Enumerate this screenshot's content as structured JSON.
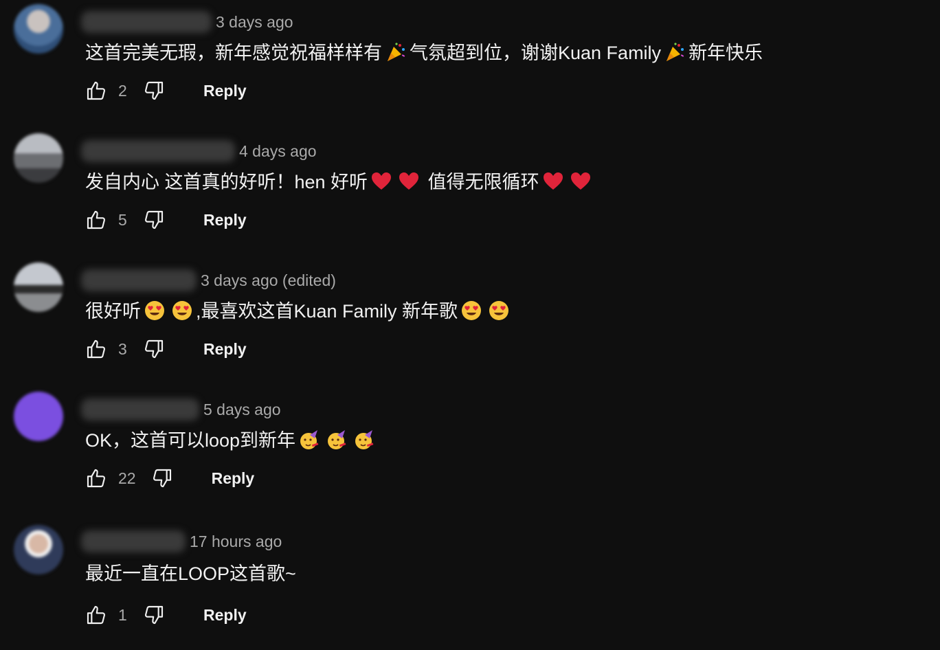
{
  "comments": [
    {
      "timestamp": "3 days ago",
      "text_parts": [
        "这首完美无瑕，新年感觉祝福样样有",
        "气氛超到位，谢谢Kuan Family",
        "新年快乐"
      ],
      "emojis": [
        "party-popper",
        "party-popper"
      ],
      "likes": "2",
      "reply_label": "Reply"
    },
    {
      "timestamp": "4 days ago",
      "text_parts": [
        "发自内心 这首真的好听！hen 好听",
        "值得无限循环"
      ],
      "emojis": [
        "red-heart",
        "red-heart",
        "red-heart",
        "red-heart"
      ],
      "likes": "5",
      "reply_label": "Reply"
    },
    {
      "timestamp": "3 days ago (edited)",
      "text_parts": [
        "很好听",
        ",最喜欢这首Kuan Family 新年歌"
      ],
      "emojis": [
        "heart-eyes",
        "heart-eyes",
        "heart-eyes",
        "heart-eyes"
      ],
      "likes": "3",
      "reply_label": "Reply"
    },
    {
      "timestamp": "5 days ago",
      "text_parts": [
        "OK，这首可以loop到新年"
      ],
      "emojis": [
        "partying-face",
        "partying-face",
        "partying-face"
      ],
      "likes": "22",
      "reply_label": "Reply"
    },
    {
      "timestamp": "17 hours ago",
      "text_parts": [
        "最近一直在LOOP这首歌~"
      ],
      "emojis": [],
      "likes": "1",
      "reply_label": "Reply"
    }
  ],
  "colors": {
    "background": "#0f0f0f",
    "text_primary": "#f1f1f1",
    "text_secondary": "#aaaaaa",
    "heart": "#e0243a",
    "purple_avatar": "#7b4fe0"
  },
  "icons": [
    "thumbs-up-icon",
    "thumbs-down-icon"
  ]
}
